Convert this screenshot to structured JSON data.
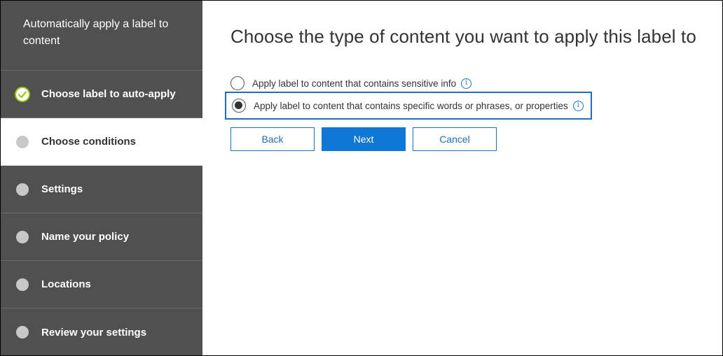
{
  "wizard": {
    "title": "Automatically apply a label to content",
    "steps": [
      {
        "label": "Choose label to auto-apply",
        "state": "completed"
      },
      {
        "label": "Choose conditions",
        "state": "current"
      },
      {
        "label": "Settings",
        "state": "pending"
      },
      {
        "label": "Name your policy",
        "state": "pending"
      },
      {
        "label": "Locations",
        "state": "pending"
      },
      {
        "label": "Review your settings",
        "state": "pending"
      }
    ]
  },
  "main": {
    "title": "Choose the type of content you want to apply this label to",
    "options": [
      {
        "label": "Apply label to content that contains sensitive info",
        "selected": false,
        "icon": "info-icon"
      },
      {
        "label": "Apply label to content that contains specific words or phrases, or properties",
        "selected": true,
        "icon": "info-icon"
      }
    ],
    "buttons": {
      "back": "Back",
      "next": "Next",
      "cancel": "Cancel"
    }
  },
  "colors": {
    "sidebar_bg": "#505050",
    "accent": "#0e78d4",
    "focus_border": "#1e6fb3",
    "check_green": "#9bc60c"
  }
}
